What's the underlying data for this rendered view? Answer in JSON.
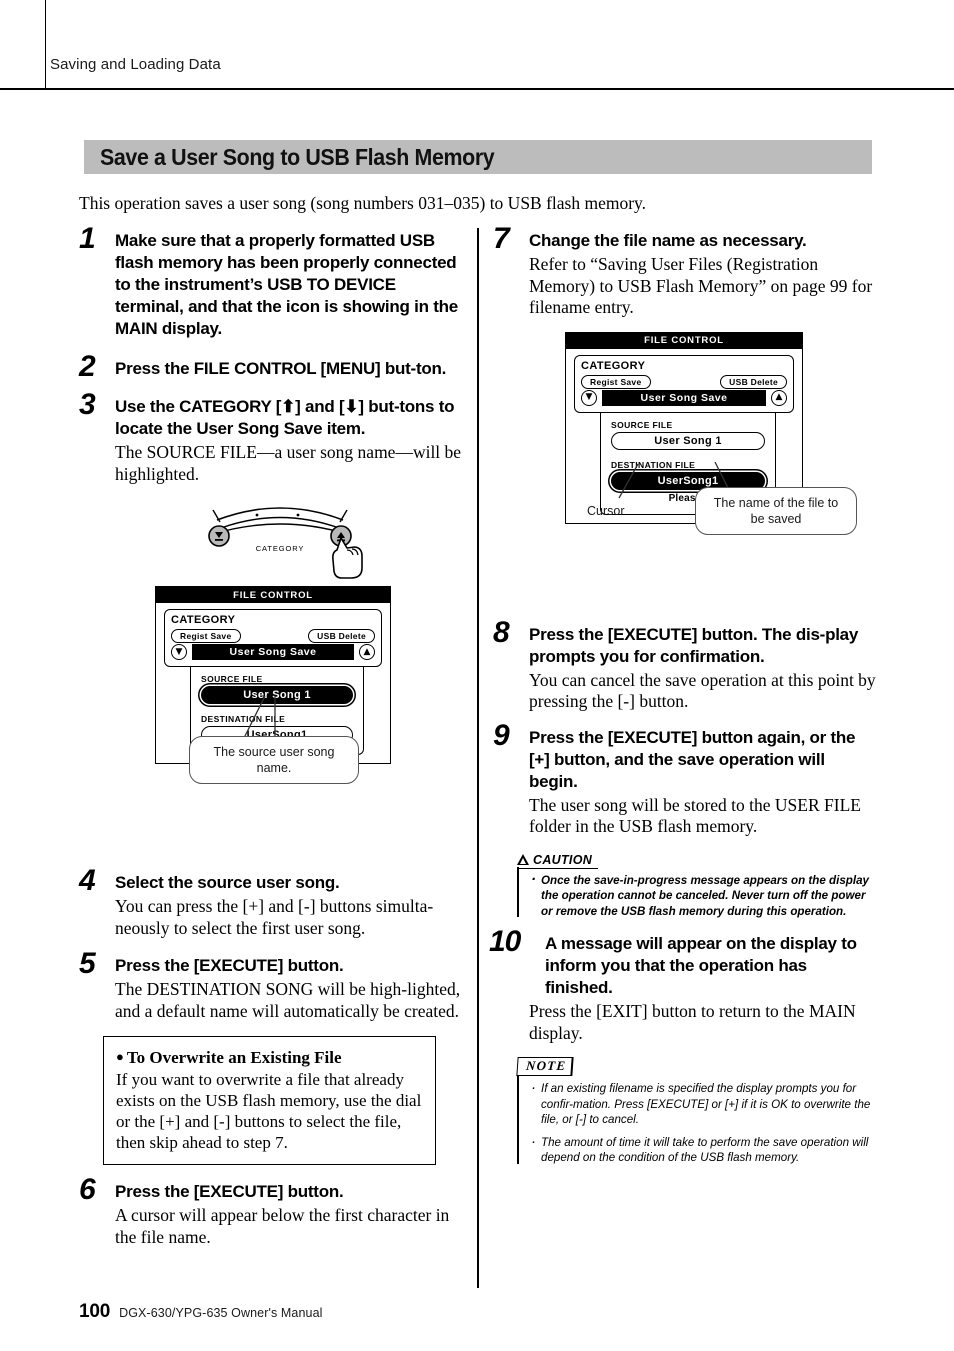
{
  "header": {
    "running_head": "Saving and Loading Data"
  },
  "section": {
    "title": "Save a User Song to USB Flash Memory",
    "intro": "This operation saves a user song (song numbers 031–035) to USB flash memory."
  },
  "left_column": {
    "steps": [
      {
        "num": "1",
        "title": "Make sure that a properly formatted USB flash memory has been properly connected to the instrument’s USB TO DEVICE terminal, and that the icon is showing in the MAIN display.",
        "body": ""
      },
      {
        "num": "2",
        "title": "Press the FILE CONTROL [MENU] but-ton.",
        "body": ""
      },
      {
        "num": "3",
        "title": "Use the CATEGORY [⬆] and [⬇] but-tons to locate the User Song Save item.",
        "body": "The SOURCE FILE—a user song name—will be highlighted."
      },
      {
        "num": "4",
        "title": "Select the source user song.",
        "body": "You can press the [+] and [-] buttons simulta-neously to select the first user song."
      },
      {
        "num": "5",
        "title": "Press the [EXECUTE] button.",
        "body": "The DESTINATION SONG will be high-lighted, and a default name will automatically be created."
      },
      {
        "num": "6",
        "title": "Press the [EXECUTE] button.",
        "body": "A cursor will appear below the first character in the file name."
      }
    ],
    "overwrite_box": {
      "title": "To Overwrite an Existing File",
      "body": "If you want to overwrite a file that already exists on the USB flash memory, use the dial or the [+] and [-] buttons to select the file, then skip ahead to step 7."
    },
    "category_illustration": {
      "label": "CATEGORY",
      "up_button": "category-up",
      "down_button": "category-down",
      "hand": "pointing-hand"
    },
    "lcd": {
      "title": "FILE CONTROL",
      "category_label": "CATEGORY",
      "left_pill": "Regist Save",
      "right_pill": "USB Delete",
      "selected_item": "User Song Save",
      "source_label": "SOURCE FILE",
      "source_value": "User Song 1",
      "destination_label": "DESTINATION FILE",
      "destination_value": "UserSong1",
      "callout": "The source user song name."
    }
  },
  "right_column": {
    "steps": [
      {
        "num": "7",
        "title": "Change the file name as necessary.",
        "body": "Refer to “Saving User Files (Registration Memory) to USB Flash Memory” on page 99 for filename entry."
      },
      {
        "num": "8",
        "title": "Press the [EXECUTE] button. The dis-play prompts you for confirmation.",
        "body": "You can cancel the save operation at this point by pressing the [-] button."
      },
      {
        "num": "9",
        "title": "Press the [EXECUTE] button again, or the [+] button, and the save operation will begin.",
        "body": "The user song will be stored to the USER FILE folder in the USB flash memory."
      },
      {
        "num": "10",
        "title": "A message will appear on the display to inform you that the operation has finished.",
        "body": "Press the [EXIT] button to return to the MAIN display."
      }
    ],
    "lcd": {
      "title": "FILE CONTROL",
      "category_label": "CATEGORY",
      "left_pill": "Regist Save",
      "right_pill": "USB Delete",
      "selected_item": "User Song Save",
      "source_label": "SOURCE FILE",
      "source_value": "User Song 1",
      "destination_label": "DESTINATION FILE",
      "destination_value": "UserSong1",
      "prompt": "Please Enter Name.",
      "cursor_label": "Cursor",
      "callout": "The name of the file to be saved"
    },
    "caution": {
      "heading": "CAUTION",
      "items": [
        "Once the save-in-progress message appears on the display the operation cannot be canceled. Never turn off the power or remove the USB flash memory during this operation."
      ]
    },
    "note": {
      "heading": "NOTE",
      "items": [
        "If an existing filename is specified the display prompts you for confir-mation. Press [EXECUTE] or [+] if it is OK to overwrite the file, or [-] to cancel.",
        "The amount of time it will take to perform the save operation will depend on the condition of the USB flash memory."
      ]
    }
  },
  "footer": {
    "page_number": "100",
    "manual": "DGX-630/YPG-635  Owner's Manual"
  }
}
